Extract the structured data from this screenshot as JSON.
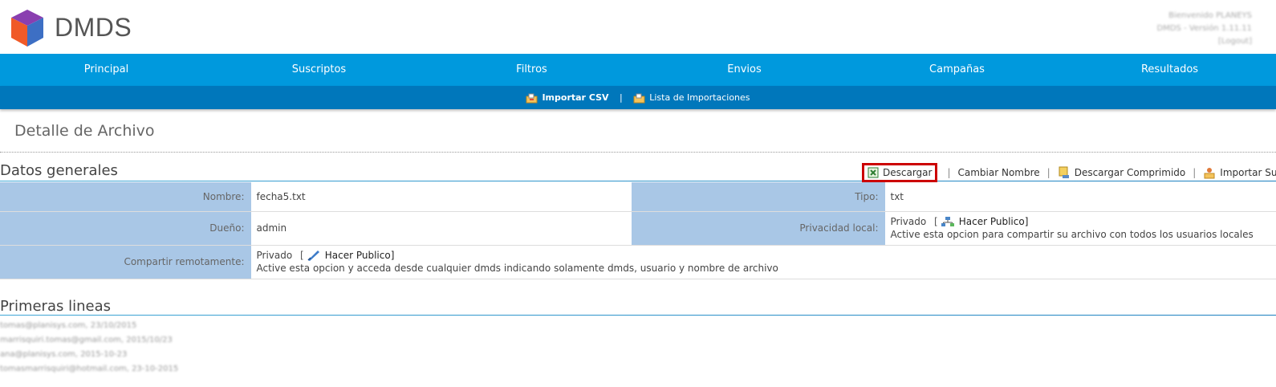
{
  "brand": {
    "name": "DMDS"
  },
  "user": {
    "welcome": "Bienvenido PLANEYS",
    "version": "DMDS - Versión 1.11.11",
    "logout": "[Logout]"
  },
  "nav": {
    "items": [
      "Principal",
      "Suscriptos",
      "Filtros",
      "Envios",
      "Campañas",
      "Resultados"
    ]
  },
  "subnav": {
    "import_csv": "Importar CSV",
    "separator": "|",
    "import_list": "Lista de Importaciones"
  },
  "page": {
    "title": "Detalle de Archivo"
  },
  "general": {
    "title": "Datos generales",
    "actions": {
      "download": "Descargar",
      "rename": "Cambiar Nombre",
      "download_zip": "Descargar Comprimido",
      "import_subscribers": "Importar Suscriptos",
      "separator": "|"
    },
    "rows": {
      "name_label": "Nombre:",
      "name_value": "fecha5.txt",
      "type_label": "Tipo:",
      "type_value": "txt",
      "owner_label": "Dueño:",
      "owner_value": "admin",
      "local_label": "Privacidad local:",
      "local_status": "Privado",
      "local_link": "Hacer Publico]",
      "local_help": "Active esta opcion para compartir su archivo con todos los usuarios locales",
      "remote_label": "Compartir remotamente:",
      "remote_status": "Privado",
      "remote_link": "Hacer Publico]",
      "remote_help": "Active esta opcion y acceda desde cualquier dmds indicando solamente dmds, usuario y nombre de archivo"
    }
  },
  "first_lines": {
    "title": "Primeras lineas",
    "items": [
      "tomas@planisys.com, 23/10/2015",
      "marrisquiri.tomas@gmail.com, 2015/10/23",
      "ana@planisys.com, 2015-10-23",
      "tomasmarrisquiri@hotmail.com, 23-10-2015"
    ]
  },
  "colors": {
    "nav": "#0099dd",
    "subnav": "#0077bb",
    "label_bg": "#a9c7e6",
    "highlight": "#cc0000"
  }
}
